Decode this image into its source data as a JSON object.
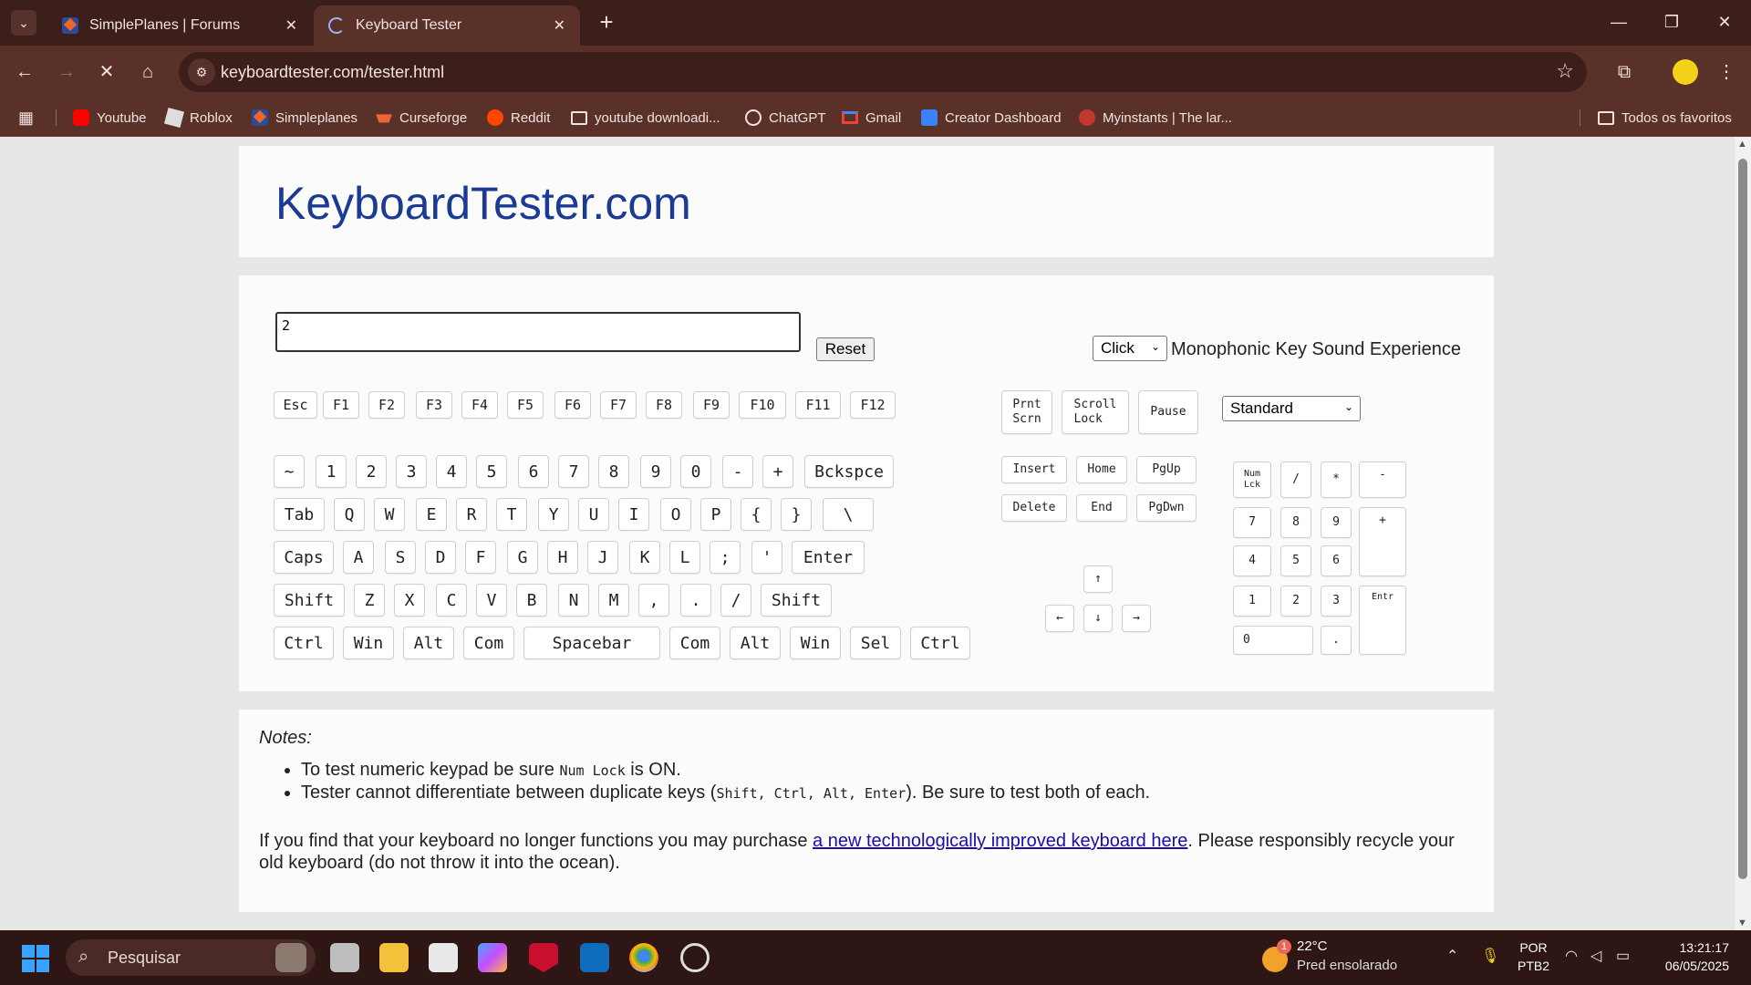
{
  "browser": {
    "tabs": [
      {
        "title": "SimplePlanes | Forums",
        "close": "✕"
      },
      {
        "title": "Keyboard Tester",
        "close": "✕"
      }
    ],
    "new_tab": "+",
    "window": {
      "minimize": "—",
      "maximize": "❐",
      "close": "✕"
    },
    "url": "keyboardtester.com/tester.html",
    "bookmarks": [
      {
        "label": "Youtube",
        "color": "#ff0000"
      },
      {
        "label": "Roblox",
        "color": "#dddddd"
      },
      {
        "label": "Simpleplanes",
        "color": "#2a4b9a"
      },
      {
        "label": "Curseforge",
        "color": "#f16436"
      },
      {
        "label": "Reddit",
        "color": "#ff4500"
      },
      {
        "label": "youtube downloadi...",
        "color": "#f2e3e0"
      },
      {
        "label": "ChatGPT",
        "color": "#f2e3e0"
      },
      {
        "label": "Gmail",
        "color": "#ea4335"
      },
      {
        "label": "Creator Dashboard",
        "color": "#3b82f6"
      },
      {
        "label": "Myinstants | The lar...",
        "color": "#c0392b"
      }
    ],
    "all_bookmarks": "Todos os favoritos"
  },
  "page": {
    "logo": "KeyboardTester.com",
    "textarea_value": "2",
    "reset": "Reset",
    "sound_select": "Click",
    "sound_label": "Monophonic Key Sound Experience",
    "layout_select": "Standard",
    "fn_row": [
      "Esc",
      "F1",
      "F2",
      "F3",
      "F4",
      "F5",
      "F6",
      "F7",
      "F8",
      "F9",
      "F10",
      "F11",
      "F12"
    ],
    "row1": [
      "~",
      "1",
      "2",
      "3",
      "4",
      "5",
      "6",
      "7",
      "8",
      "9",
      "0",
      "-",
      "+",
      "Bckspce"
    ],
    "row2": [
      "Tab",
      "Q",
      "W",
      "E",
      "R",
      "T",
      "Y",
      "U",
      "I",
      "O",
      "P",
      "{",
      "}",
      "\\"
    ],
    "row3": [
      "Caps",
      "A",
      "S",
      "D",
      "F",
      "G",
      "H",
      "J",
      "K",
      "L",
      ";",
      "'",
      "Enter"
    ],
    "row4": [
      "Shift",
      "Z",
      "X",
      "C",
      "V",
      "B",
      "N",
      "M",
      ",",
      ".",
      "/",
      "Shift"
    ],
    "row5": [
      "Ctrl",
      "Win",
      "Alt",
      "Com",
      "Spacebar",
      "Com",
      "Alt",
      "Win",
      "Sel",
      "Ctrl"
    ],
    "sys_keys": [
      "Prnt\nScrn",
      "Scroll\nLock",
      "Pause"
    ],
    "nav_keys": [
      "Insert",
      "Home",
      "PgUp",
      "Delete",
      "End",
      "PgDwn"
    ],
    "arrows": [
      "↑",
      "←",
      "↓",
      "→"
    ],
    "numpad": [
      "Num\nLck",
      "/",
      "*",
      "-",
      "7",
      "8",
      "9",
      "+",
      "4",
      "5",
      "6",
      "1",
      "2",
      "3",
      "Entr",
      "0",
      "."
    ],
    "notes": {
      "title": "Notes:",
      "item1_pre": "To test numeric keypad be sure ",
      "item1_code": "Num Lock",
      "item1_post": " is ON.",
      "item2_pre": "Tester cannot differentiate between duplicate keys (",
      "item2_code": "Shift, Ctrl, Alt, Enter",
      "item2_post": "). Be sure to test both of each.",
      "para_pre": "If you find that your keyboard no longer functions you may purchase ",
      "para_link": "a new technologically improved keyboard here",
      "para_post": ". Please responsibly recycle your old keyboard (do not throw it into the ocean)."
    }
  },
  "taskbar": {
    "search_placeholder": "Pesquisar",
    "weather_badge": "1",
    "weather_temp": "22°C",
    "weather_desc": "Pred ensolarado",
    "lang_line1": "POR",
    "lang_line2": "PTB2",
    "time": "13:21:17",
    "date": "06/05/2025"
  }
}
